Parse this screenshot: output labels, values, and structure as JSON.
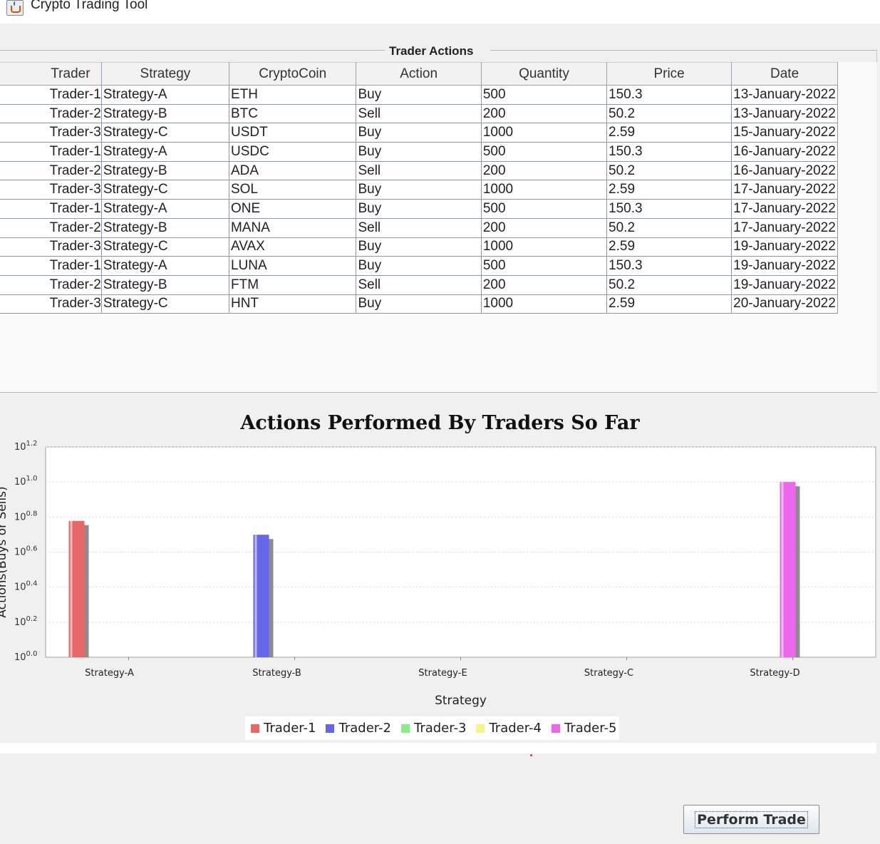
{
  "window": {
    "title": "Crypto Trading Tool"
  },
  "trader_actions": {
    "title": "Trader Actions",
    "columns": [
      "Trader",
      "Strategy",
      "CryptoCoin",
      "Action",
      "Quantity",
      "Price",
      "Date"
    ],
    "rows": [
      [
        "Trader-1",
        "Strategy-A",
        "ETH",
        "Buy",
        "500",
        "150.3",
        "13-January-2022"
      ],
      [
        "Trader-2",
        "Strategy-B",
        "BTC",
        "Sell",
        "200",
        "50.2",
        "13-January-2022"
      ],
      [
        "Trader-3",
        "Strategy-C",
        "USDT",
        "Buy",
        "1000",
        "2.59",
        "15-January-2022"
      ],
      [
        "Trader-1",
        "Strategy-A",
        "USDC",
        "Buy",
        "500",
        "150.3",
        "16-January-2022"
      ],
      [
        "Trader-2",
        "Strategy-B",
        "ADA",
        "Sell",
        "200",
        "50.2",
        "16-January-2022"
      ],
      [
        "Trader-3",
        "Strategy-C",
        "SOL",
        "Buy",
        "1000",
        "2.59",
        "17-January-2022"
      ],
      [
        "Trader-1",
        "Strategy-A",
        "ONE",
        "Buy",
        "500",
        "150.3",
        "17-January-2022"
      ],
      [
        "Trader-2",
        "Strategy-B",
        "MANA",
        "Sell",
        "200",
        "50.2",
        "17-January-2022"
      ],
      [
        "Trader-3",
        "Strategy-C",
        "AVAX",
        "Buy",
        "1000",
        "2.59",
        "19-January-2022"
      ],
      [
        "Trader-1",
        "Strategy-A",
        "LUNA",
        "Buy",
        "500",
        "150.3",
        "19-January-2022"
      ],
      [
        "Trader-2",
        "Strategy-B",
        "FTM",
        "Sell",
        "200",
        "50.2",
        "19-January-2022"
      ],
      [
        "Trader-3",
        "Strategy-C",
        "HNT",
        "Buy",
        "1000",
        "2.59",
        "20-January-2022"
      ]
    ]
  },
  "chart_data": {
    "type": "bar",
    "title": "Actions Performed By Traders So Far",
    "xlabel": "Strategy",
    "ylabel": "Actions(Buys or Sells)",
    "y_scale": "log10",
    "ylim_exponent": [
      0,
      1.2
    ],
    "y_ticks": [
      "10^0.0",
      "10^0.2",
      "10^0.4",
      "10^0.6",
      "10^0.8",
      "10^1.0",
      "10^1.2"
    ],
    "categories": [
      "Strategy-A",
      "Strategy-B",
      "Strategy-E",
      "Strategy-C",
      "Strategy-D"
    ],
    "series": [
      {
        "name": "Trader-1",
        "color": "#e86666",
        "values": [
          6,
          null,
          null,
          null,
          null
        ]
      },
      {
        "name": "Trader-2",
        "color": "#6666e8",
        "values": [
          null,
          5,
          null,
          null,
          null
        ]
      },
      {
        "name": "Trader-3",
        "color": "#88ee88",
        "values": [
          null,
          null,
          null,
          null,
          null
        ]
      },
      {
        "name": "Trader-4",
        "color": "#f4f488",
        "values": [
          null,
          null,
          null,
          null,
          null
        ]
      },
      {
        "name": "Trader-5",
        "color": "#ee66ee",
        "values": [
          null,
          null,
          null,
          null,
          10
        ]
      }
    ],
    "grid": true,
    "legend_position": "bottom"
  },
  "perform_button": {
    "label": "Perform Trade"
  }
}
